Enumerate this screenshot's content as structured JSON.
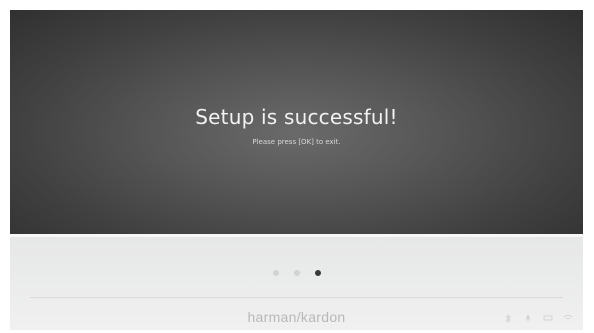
{
  "screen": {
    "title": "Setup is successful!",
    "subtitle": "Please press [OK] to exit."
  },
  "pager": {
    "total_steps": 3,
    "current_step": 3
  },
  "footer": {
    "brand": "harman/kardon",
    "control_icons": [
      "bluetooth-icon",
      "microphone-icon",
      "network-icon",
      "wifi-icon"
    ]
  },
  "colors": {
    "screen_dark": "#303030",
    "screen_light": "#6a6a6a",
    "panel": "#eceded",
    "dot_active": "#3a3a3a",
    "dot_inactive": "#d2d2d2",
    "brand_text": "#b8b8b8"
  }
}
